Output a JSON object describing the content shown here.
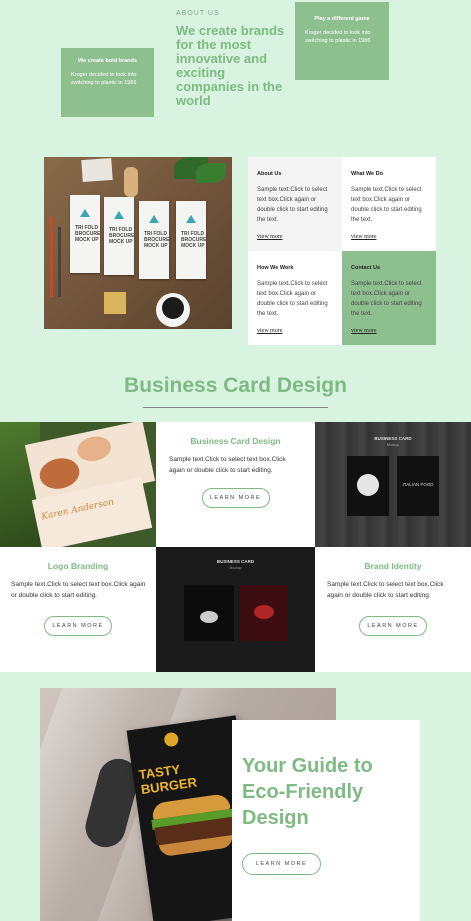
{
  "hero": {
    "about_label": "ABOUT US",
    "title": "We create brands for the most innovative and exciting companies in the world"
  },
  "cards": {
    "left": {
      "title": "We create bold brands",
      "body": "Kroger decided to look into switching to plastic in 1986"
    },
    "right": {
      "title": "Play a different game",
      "body": "Kroger decided to look into switching to plastic in 1986"
    }
  },
  "brochure": {
    "panel_text": "TRI FOLD BROCURE MOCK UP"
  },
  "info": [
    {
      "title": "About Us",
      "body": "Sample text.Click to select text box.Click again or double click to start editing the text.",
      "link": "view more"
    },
    {
      "title": "What We Do",
      "body": "Sample text.Click to select text box.Click again or double click to start editing the text.",
      "link": "view more"
    },
    {
      "title": "How We Work",
      "body": "Sample text.Click to select text box.Click again or double click to start editing the text.",
      "link": "view more"
    },
    {
      "title": "Contact Us",
      "body": "Sample text.Click to select text box.Click again or double click to start editing the text.",
      "link": "view more"
    }
  ],
  "section": {
    "title": "Business Card Design"
  },
  "services": {
    "card_design": {
      "title": "Business Card Design",
      "body": "Sample text.Click to select text box.Click again or double click to start editing.",
      "button": "LEARN MORE"
    },
    "logo": {
      "title": "Logo Branding",
      "body": "Sample text.Click to select text box.Click again or double click to start editing.",
      "button": "LEARN MORE"
    },
    "identity": {
      "title": "Brand Identity",
      "body": "Sample text.Click to select text box.Click again or double click to start editing.",
      "button": "LEARN MORE"
    }
  },
  "mock": {
    "bc1": "BUSINESS CARD",
    "bc1_sub": "Mockup",
    "bc1_food": "ITALIAN FOOD",
    "bc2": "BUSINESS CARD",
    "bc2_sub": "Mockup",
    "card_name": "Karen Anderson",
    "burger": "TASTY BURGER"
  },
  "guide": {
    "title": "Your Guide to Eco-Friendly Design",
    "button": "LEARN MORE"
  },
  "colors": {
    "accent": "#7fba84",
    "card_green": "#8ec08f",
    "background": "#d8f3df"
  }
}
